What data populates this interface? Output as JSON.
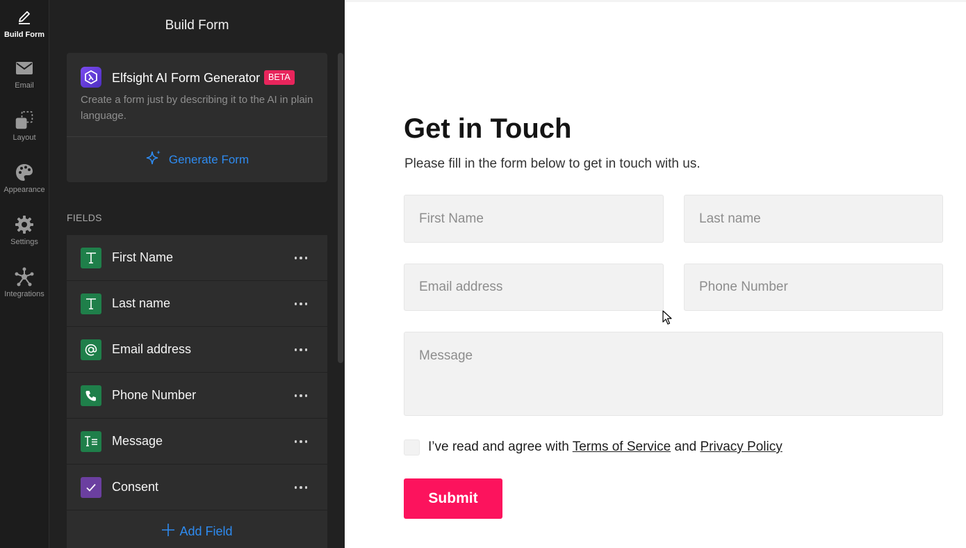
{
  "rail": {
    "items": [
      {
        "label": "Build Form",
        "icon": "pencil-icon",
        "active": true
      },
      {
        "label": "Email",
        "icon": "envelope-icon"
      },
      {
        "label": "Layout",
        "icon": "layout-icon"
      },
      {
        "label": "Appearance",
        "icon": "palette-icon"
      },
      {
        "label": "Settings",
        "icon": "gear-icon"
      },
      {
        "label": "Integrations",
        "icon": "integrations-icon"
      }
    ]
  },
  "panel": {
    "title": "Build Form",
    "ai": {
      "title": "Elfsight AI Form Generator",
      "badge": "BETA",
      "description": "Create a form just by describing it to the AI in plain language.",
      "generate_label": "Generate Form"
    },
    "fields_heading": "FIELDS",
    "fields": [
      {
        "label": "First Name",
        "icon": "text-icon",
        "color": "#1f7f4a"
      },
      {
        "label": "Last name",
        "icon": "text-icon",
        "color": "#1f7f4a"
      },
      {
        "label": "Email address",
        "icon": "at-icon",
        "color": "#1f7f4a"
      },
      {
        "label": "Phone Number",
        "icon": "phone-icon",
        "color": "#1f7f4a"
      },
      {
        "label": "Message",
        "icon": "textarea-icon",
        "color": "#1f7f4a"
      },
      {
        "label": "Consent",
        "icon": "checkbox-icon",
        "color": "#6b3fa0"
      }
    ],
    "add_field_label": "Add Field"
  },
  "preview": {
    "title": "Get in Touch",
    "subtitle": "Please fill in the form below to get in touch with us.",
    "placeholders": {
      "first_name": "First Name",
      "last_name": "Last name",
      "email": "Email address",
      "phone": "Phone Number",
      "message": "Message"
    },
    "consent": {
      "prefix": "I’ve read and agree with ",
      "terms": "Terms of Service",
      "and": " and ",
      "privacy": "Privacy Policy"
    },
    "submit_label": "Submit"
  },
  "colors": {
    "accent_blue": "#2e8bf0",
    "submit_pink": "#fc135d",
    "badge_pink": "#e8255c",
    "field_green": "#1f7f4a",
    "consent_purple": "#6b3fa0"
  }
}
